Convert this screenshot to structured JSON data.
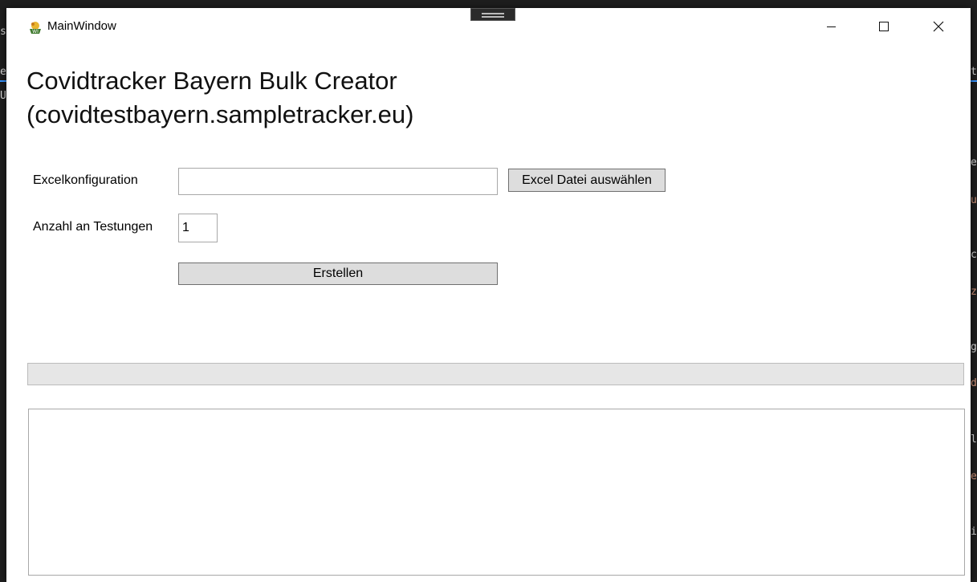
{
  "window": {
    "title": "MainWindow"
  },
  "background_fragments": {
    "left": [
      "s",
      "e",
      "U"
    ],
    "right": [
      "e",
      "u",
      "c",
      "z",
      "g",
      "d",
      "l",
      "e",
      "i"
    ],
    "top_right": "t"
  },
  "header": {
    "line1": "Covidtracker Bayern Bulk Creator",
    "line2": "(covidtestbayern.sampletracker.eu)"
  },
  "form": {
    "excel_label": "Excelkonfiguration",
    "excel_path_value": "",
    "excel_button_label": "Excel Datei auswählen",
    "count_label": "Anzahl an Testungen",
    "count_value": "1",
    "create_button_label": "Erstellen"
  },
  "progress": {
    "value": 0
  },
  "log": {
    "value": ""
  },
  "colors": {
    "progress_fill": "#06b025",
    "background_accent": "#3794ff"
  }
}
